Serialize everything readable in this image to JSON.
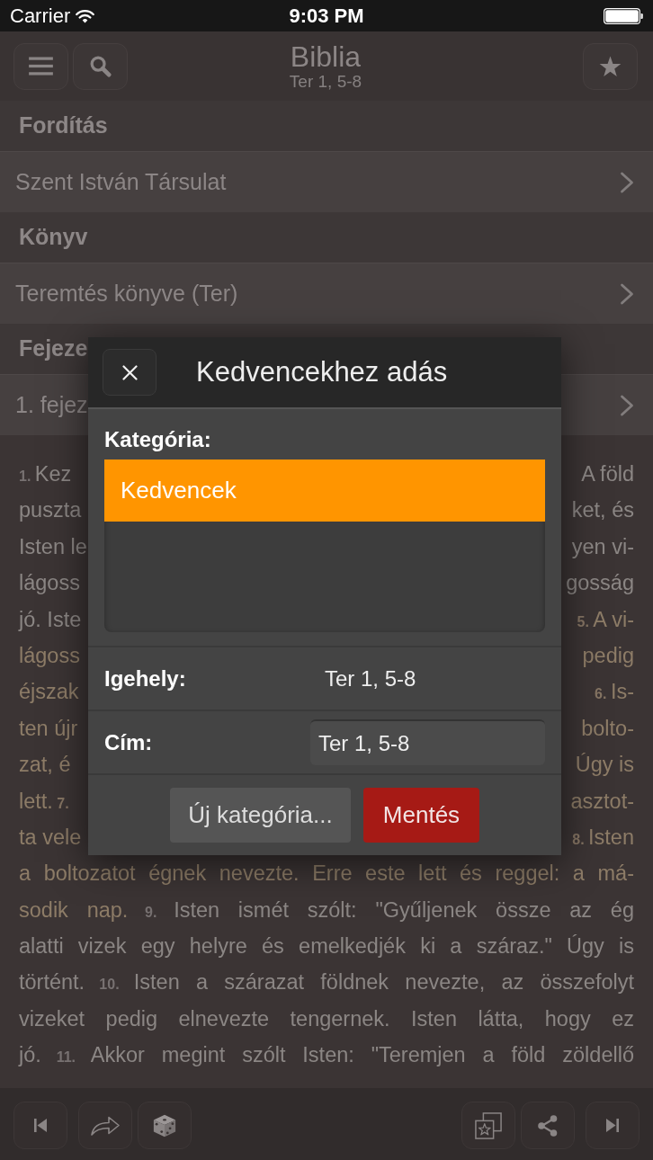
{
  "status_bar": {
    "carrier": "Carrier",
    "time": "9:03 PM"
  },
  "nav_bar": {
    "title": "Biblia",
    "subtitle": "Ter 1, 5-8"
  },
  "sections": [
    {
      "header": "Fordítás",
      "value": "Szent István Társulat"
    },
    {
      "header": "Könyv",
      "value": "Teremtés könyve (Ter)"
    },
    {
      "header": "Fejeze",
      "value": "1. fejez"
    }
  ],
  "text_lines": [
    {
      "left": [
        {
          "kind": "number",
          "text": "1.",
          "highlighted": false
        },
        {
          "kind": "text",
          "text": "Kez",
          "highlighted": false
        }
      ],
      "right": [
        {
          "kind": "text",
          "text": "A föld",
          "highlighted": false
        }
      ]
    },
    {
      "left": [
        {
          "kind": "text",
          "text": "puszta",
          "highlighted": false
        }
      ],
      "right": [
        {
          "kind": "text",
          "text": "ket, és",
          "highlighted": false
        }
      ]
    },
    {
      "left": [
        {
          "kind": "text",
          "text": "Isten le",
          "highlighted": false
        }
      ],
      "right": [
        {
          "kind": "text",
          "text": "yen vi-",
          "highlighted": false
        }
      ]
    },
    {
      "left": [
        {
          "kind": "text",
          "text": "lágoss",
          "highlighted": false
        }
      ],
      "right": [
        {
          "kind": "text",
          "text": "gosság",
          "highlighted": false
        }
      ]
    },
    {
      "left": [
        {
          "kind": "text",
          "text": "jó. Iste",
          "highlighted": false
        }
      ],
      "right": [
        {
          "kind": "number",
          "text": "5.",
          "highlighted": true
        },
        {
          "kind": "text",
          "text": "A vi-",
          "highlighted": true
        }
      ]
    },
    {
      "left": [
        {
          "kind": "text",
          "text": "lágoss",
          "highlighted": true
        }
      ],
      "right": [
        {
          "kind": "text",
          "text": "pedig",
          "highlighted": true
        }
      ]
    },
    {
      "left": [
        {
          "kind": "text",
          "text": "éjszak",
          "highlighted": true
        }
      ],
      "right": [
        {
          "kind": "number",
          "text": "6.",
          "highlighted": true
        },
        {
          "kind": "text",
          "text": "Is-",
          "highlighted": true
        }
      ]
    },
    {
      "left": [
        {
          "kind": "text",
          "text": "ten újr",
          "highlighted": true
        }
      ],
      "right": [
        {
          "kind": "text",
          "text": "bolto-",
          "highlighted": true
        }
      ]
    },
    {
      "left": [
        {
          "kind": "text",
          "text": "zat, é",
          "highlighted": true
        }
      ],
      "right": [
        {
          "kind": "text",
          "text": "Úgy is",
          "highlighted": true
        }
      ]
    },
    {
      "left": [
        {
          "kind": "text",
          "text": "lett.",
          "highlighted": true
        },
        {
          "kind": "number",
          "text": "7.",
          "highlighted": true
        }
      ],
      "right": [
        {
          "kind": "text",
          "text": "asztot-",
          "highlighted": true
        }
      ]
    },
    {
      "left": [
        {
          "kind": "text",
          "text": "ta vele",
          "highlighted": true
        }
      ],
      "right": [
        {
          "kind": "number",
          "text": "8.",
          "highlighted": true
        },
        {
          "kind": "text",
          "text": "Isten",
          "highlighted": true
        }
      ]
    },
    {
      "segments": [
        {
          "kind": "text",
          "text": "a boltozatot égnek nevezte. Erre este lett és reggel: a má-",
          "highlighted": true
        }
      ]
    },
    {
      "segments": [
        {
          "kind": "text",
          "text": "sodik nap.",
          "highlighted": true
        },
        {
          "kind": "number",
          "text": "9.",
          "highlighted": false
        },
        {
          "kind": "text",
          "text": "Isten ismét szólt: \"Gyűljenek össze az ég",
          "highlighted": false
        }
      ]
    },
    {
      "segments": [
        {
          "kind": "text",
          "text": "alatti vizek egy helyre és emelkedjék ki a száraz.\" Úgy is",
          "highlighted": false
        }
      ]
    },
    {
      "segments": [
        {
          "kind": "text",
          "text": "történt.",
          "highlighted": false
        },
        {
          "kind": "number",
          "text": "10.",
          "highlighted": false
        },
        {
          "kind": "text",
          "text": "Isten a szárazat földnek nevezte, az összefolyt",
          "highlighted": false
        }
      ]
    },
    {
      "segments": [
        {
          "kind": "text",
          "text": "vizeket pedig elnevezte tengernek. Isten látta, hogy ez",
          "highlighted": false
        }
      ]
    },
    {
      "segments": [
        {
          "kind": "text",
          "text": "jó.",
          "highlighted": false
        },
        {
          "kind": "number",
          "text": "11.",
          "highlighted": false
        },
        {
          "kind": "text",
          "text": "Akkor megint szólt Isten: \"Teremjen a föld zöldellő",
          "highlighted": false
        }
      ]
    }
  ],
  "dialog": {
    "title": "Kedvencekhez adás",
    "category_label": "Kategória:",
    "categories": [
      {
        "label": "Kedvencek",
        "selected": true
      }
    ],
    "fields": [
      {
        "kind": "text",
        "label": "Igehely:",
        "value": "Ter 1, 5-8"
      },
      {
        "kind": "input",
        "label": "Cím:",
        "value": "Ter 1, 5-8"
      }
    ],
    "buttons": [
      {
        "kind": "secondary",
        "label": "Új kategória..."
      },
      {
        "kind": "primary",
        "label": "Mentés"
      }
    ]
  }
}
